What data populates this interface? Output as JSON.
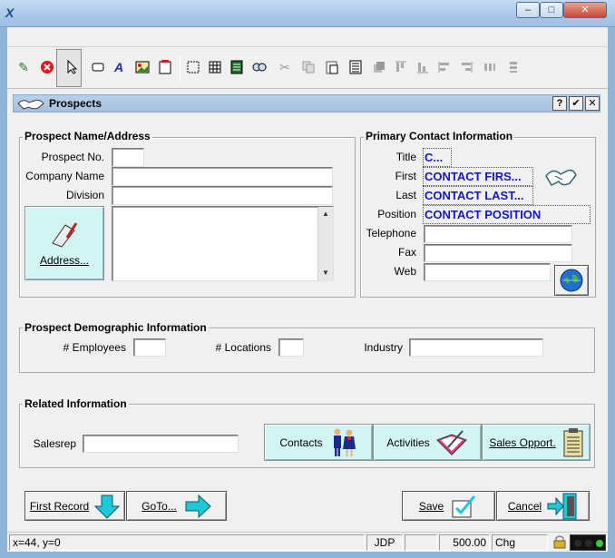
{
  "window": {
    "app_icon": "X",
    "controls": {
      "minimize": "–",
      "maximize": "□",
      "close": "✕"
    }
  },
  "toolbar": {
    "icons": [
      "save-check-icon",
      "cancel-icon",
      "pointer-icon",
      "button-icon",
      "label-a-icon",
      "image-icon",
      "form-icon",
      "select-box-icon",
      "grid-icon",
      "list-icon",
      "find-icon",
      "cut-icon",
      "copy-icon",
      "paste-icon",
      "properties-icon",
      "bring-front-icon",
      "align-top-icon",
      "align-bottom-icon",
      "align-left-icon",
      "align-right-icon",
      "space-horizontal-icon",
      "space-vertical-icon"
    ]
  },
  "doc_window": {
    "title": "Prospects",
    "help_label": "?",
    "ok_label": "✔",
    "close_label": "✕"
  },
  "prospect_group": {
    "label": "Prospect Name/Address",
    "prospect_no_label": "Prospect No.",
    "prospect_no_value": "",
    "company_label": "Company Name",
    "company_value": "",
    "division_label": "Division",
    "division_value": "",
    "address_button_label": "Address...",
    "address_value": ""
  },
  "contact_group": {
    "label": "Primary Contact Information",
    "title_label": "Title",
    "title_value": "C...",
    "first_label": "First",
    "first_value": "CONTACT FIRS...",
    "last_label": "Last",
    "last_value": "CONTACT LAST...",
    "position_label": "Position",
    "position_value": "CONTACT POSITION",
    "telephone_label": "Telephone",
    "telephone_value": "",
    "fax_label": "Fax",
    "fax_value": "",
    "web_label": "Web",
    "web_value": ""
  },
  "demographic_group": {
    "label": "Prospect Demographic Information",
    "employees_label": "# Employees",
    "employees_value": "",
    "locations_label": "# Locations",
    "locations_value": "",
    "industry_label": "Industry",
    "industry_value": ""
  },
  "related_group": {
    "label": "Related Information",
    "salesrep_label": "Salesrep",
    "salesrep_value": "",
    "contacts_button": "Contacts",
    "activities_button": "Activities",
    "sales_opp_button": "Sales Opport."
  },
  "footer_buttons": {
    "first_record": "First Record",
    "goto": "GoTo...",
    "save": "Save",
    "cancel": "Cancel"
  },
  "status_bar": {
    "coords": "x=44, y=0",
    "user": "JDP",
    "amount": "500.00",
    "mode": "Chg"
  },
  "colors": {
    "contact_text": "#1515c8",
    "cyan_button": "#d2f5f4",
    "title_bar": "#a4c1e0"
  }
}
